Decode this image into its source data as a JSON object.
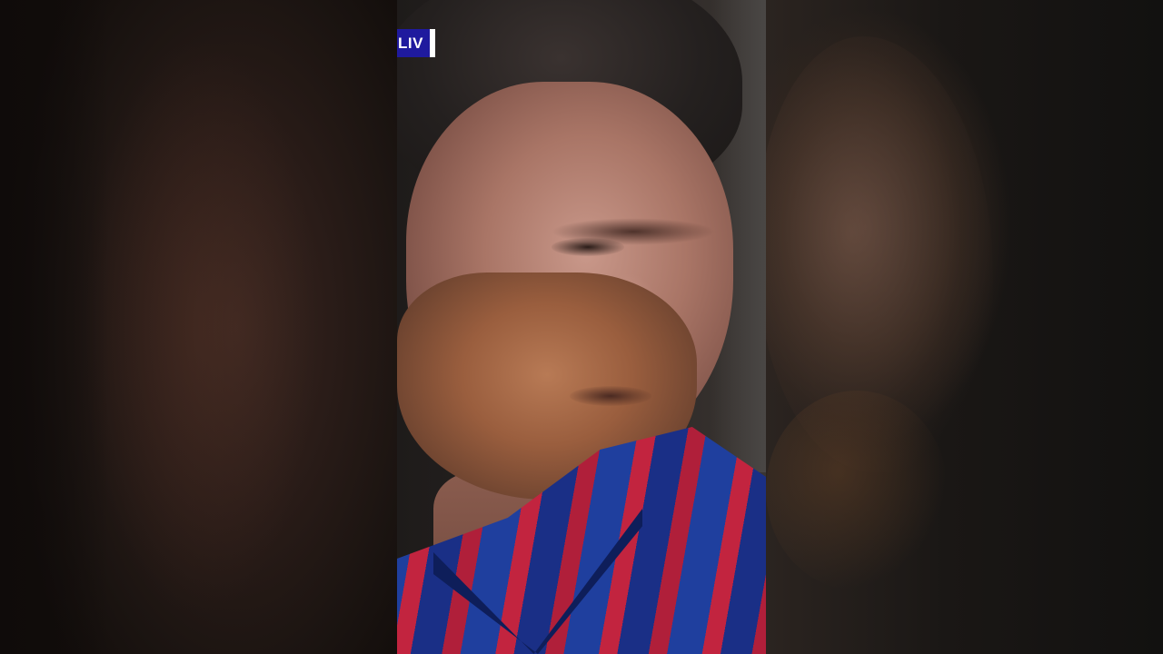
{
  "scorebug": {
    "text": "LIV",
    "accent": "#1f1a9e"
  }
}
